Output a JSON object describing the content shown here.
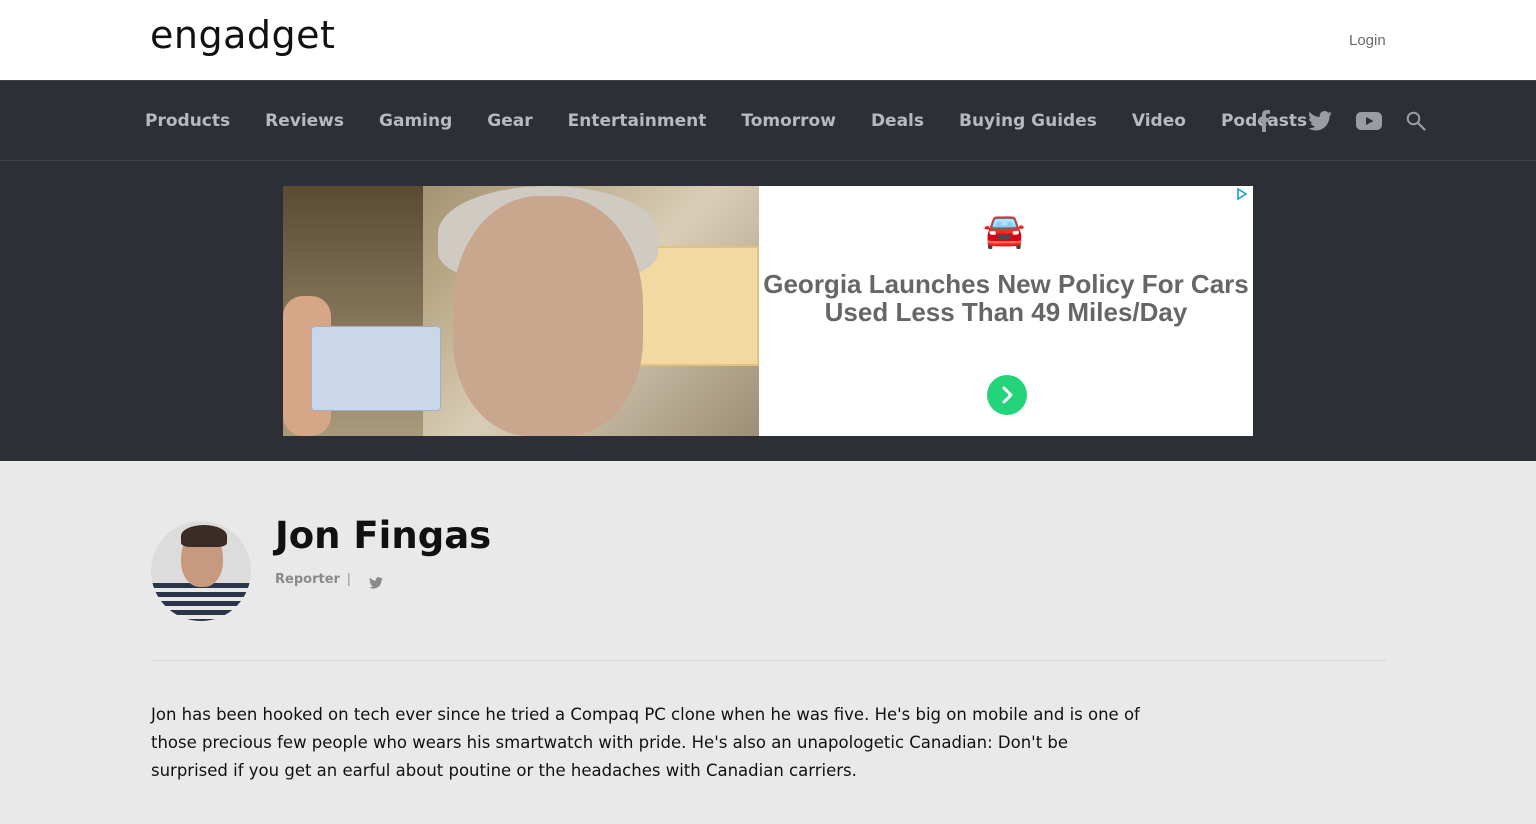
{
  "header": {
    "logo_text": "engadget",
    "login_label": "Login"
  },
  "nav": {
    "items": [
      "Products",
      "Reviews",
      "Gaming",
      "Gear",
      "Entertainment",
      "Tomorrow",
      "Deals",
      "Buying Guides",
      "Video",
      "Podcasts"
    ],
    "social_icons": [
      "facebook-icon",
      "twitter-icon",
      "youtube-icon",
      "search-icon"
    ]
  },
  "ad": {
    "emoji": "🚘",
    "headline": "Georgia Launches New Policy For Cars Used Less Than 49 Miles/Day",
    "cta_icon": "chevron-right-icon",
    "choices_icon": "adchoices-icon"
  },
  "author": {
    "name": "Jon Fingas",
    "role": "Reporter",
    "separator": "|",
    "bio": "Jon has been hooked on tech ever since he tried a Compaq PC clone when he was five. He's big on mobile and is one of those precious few people who wears his smartwatch with pride. He's also an unapologetic Canadian: Don't be surprised if you get an earful about poutine or the headaches with Canadian carriers."
  },
  "colors": {
    "nav_bg": "#2d2f36",
    "nav_text": "#b7b9bf",
    "page_bg": "#e9e9e9",
    "cta_green": "#23d47a"
  }
}
